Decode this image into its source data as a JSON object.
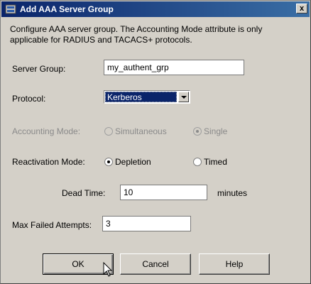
{
  "window": {
    "title": "Add AAA Server Group",
    "close_label": "x"
  },
  "description": "Configure AAA server group.  The Accounting Mode attribute is only applicable for RADIUS and TACACS+ protocols.",
  "server_group": {
    "label": "Server Group:",
    "value": "my_authent_grp"
  },
  "protocol": {
    "label": "Protocol:",
    "selected": "Kerberos"
  },
  "accounting_mode": {
    "label": "Accounting Mode:",
    "options": [
      "Simultaneous",
      "Single"
    ],
    "selected": "Single",
    "enabled": false
  },
  "reactivation_mode": {
    "label": "Reactivation Mode:",
    "options": [
      "Depletion",
      "Timed"
    ],
    "selected": "Depletion"
  },
  "dead_time": {
    "label": "Dead Time:",
    "value": "10",
    "unit": "minutes"
  },
  "max_failed": {
    "label": "Max Failed Attempts:",
    "value": "3"
  },
  "buttons": {
    "ok": "OK",
    "cancel": "Cancel",
    "help": "Help"
  }
}
